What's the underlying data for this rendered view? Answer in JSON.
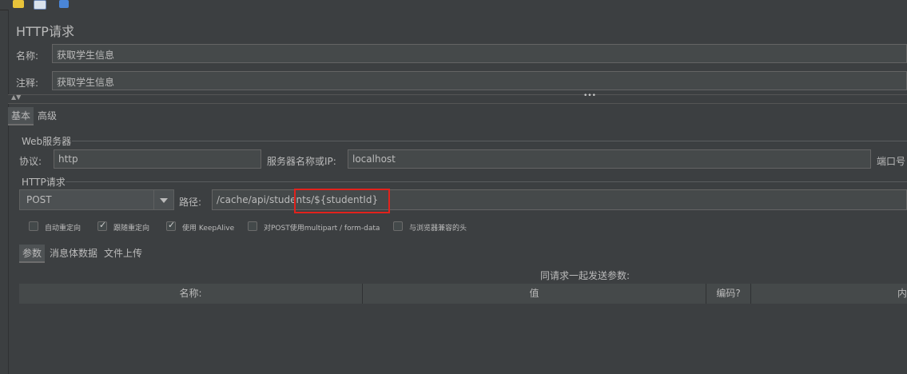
{
  "toolbar": {
    "icons": [
      "tag-icon",
      "list-icon",
      "info-icon"
    ]
  },
  "panel": {
    "title": "HTTP请求",
    "name_label": "名称:",
    "name_value": "获取学生信息",
    "comment_label": "注释:",
    "comment_value": "获取学生信息",
    "divider_handle": "•••"
  },
  "tabs": {
    "basic": "基本",
    "advanced": "高级"
  },
  "web_server": {
    "legend": "Web服务器",
    "protocol_label": "协议:",
    "protocol_value": "http",
    "server_label": "服务器名称或IP:",
    "server_value": "localhost",
    "port_label": "端口号"
  },
  "http_request": {
    "legend": "HTTP请求",
    "method": "POST",
    "path_label": "路径:",
    "path_value": "/cache/api/students/${studentId}"
  },
  "options": [
    {
      "label": "自动重定向",
      "checked": false
    },
    {
      "label": "跟随重定向",
      "checked": true
    },
    {
      "label": "使用 KeepAlive",
      "checked": true
    },
    {
      "label": "对POST使用multipart / form-data",
      "checked": false
    },
    {
      "label": "与浏览器兼容的头",
      "checked": false
    }
  ],
  "subtabs": {
    "params": "参数",
    "body": "消息体数据",
    "files": "文件上传"
  },
  "params_table": {
    "caption": "同请求一起发送参数:",
    "columns": [
      "名称:",
      "值",
      "编码?",
      "内"
    ]
  }
}
